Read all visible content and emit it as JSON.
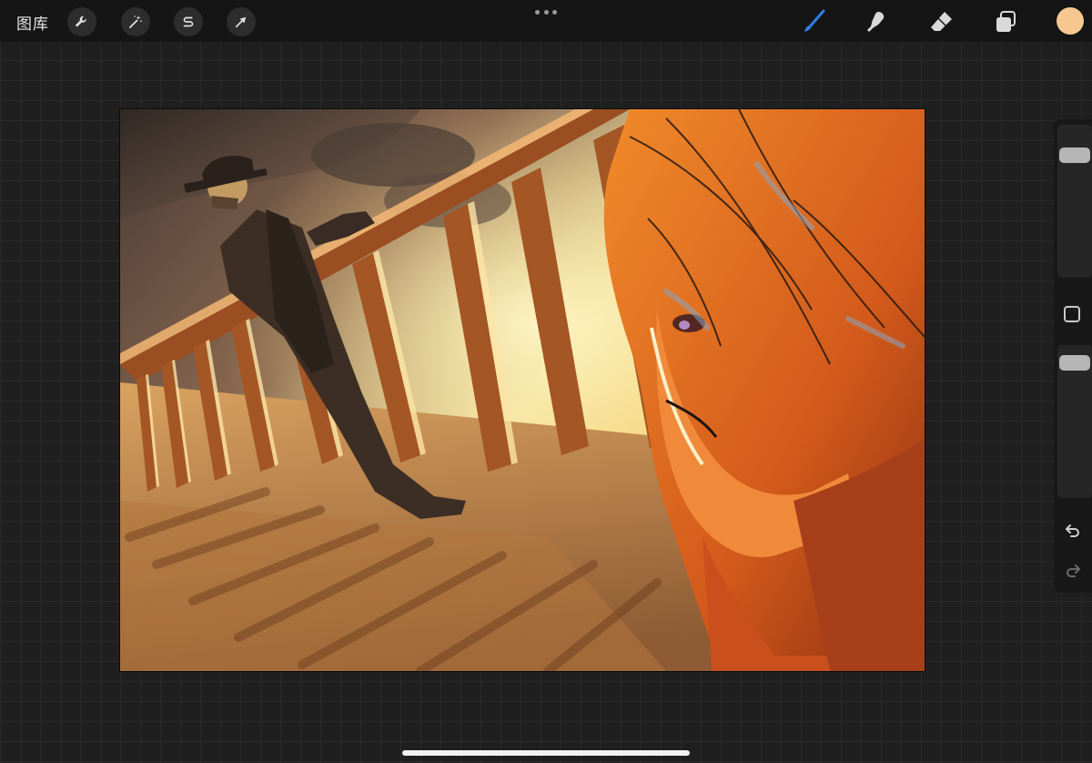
{
  "topbar": {
    "gallery_label": "图库",
    "left_tools": [
      "wrench-icon",
      "magic-wand-icon",
      "selection-s-icon",
      "transform-arrow-icon"
    ],
    "right_tools": [
      "brush-icon",
      "smudge-icon",
      "eraser-icon",
      "layers-icon"
    ],
    "active_tool": "brush-icon",
    "current_color": "#f6c88f"
  },
  "colors": {
    "accent": "#2f7fe8",
    "toolbar_bg": "#151515",
    "workspace_bg": "#1f1f1f"
  },
  "sidebar": {
    "brush_size_level": 0.15,
    "opacity_level": 0.05
  }
}
